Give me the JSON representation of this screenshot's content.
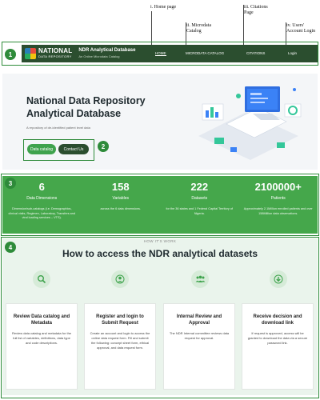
{
  "annotations": {
    "home": "i. Home page",
    "microdata": "ii. Microdata\nCatalog",
    "citations": "iii. Citations\nPage",
    "login": "iv. Users'\nAccount Login"
  },
  "badges": [
    "1",
    "2",
    "3",
    "4"
  ],
  "header": {
    "brand_line1": "NATIONAL",
    "brand_line2": "DATA REPOSITORY",
    "site_title": "NDR Analytical Database",
    "site_subtitle": "An Online Microdata Catalog",
    "nav": [
      "HOME",
      "MICRODATA CATALOG",
      "CITATIONS",
      "Login"
    ]
  },
  "hero": {
    "title": "National Data Repository Analytical Database",
    "subtitle": "A repository of de-identified patient level data",
    "btn_catalog": "Data catalog",
    "btn_contact": "Contact Us"
  },
  "stats": [
    {
      "num": "6",
      "label": "Data Dimensions",
      "desc": "Dimension/sub-catalogs (i.e. Demographics, clinical visits, Regimen, Laboratory, Transfers and viral loading services – VTS)."
    },
    {
      "num": "158",
      "label": "Variables",
      "desc": "across the 6 data dimensions."
    },
    {
      "num": "222",
      "label": "Datasets",
      "desc": "for the 36 states and 1 Federal Capital Territory of Nigeria."
    },
    {
      "num": "2100000+",
      "label": "Patients",
      "desc": "Approximately 2.1Million enrolled patients and over 158Million data observations."
    }
  ],
  "how": {
    "kicker": "HOW IT'S WORK",
    "title": "How to access the NDR analytical datasets",
    "cards": [
      {
        "title": "Review Data catalog and Metadata",
        "desc": "Review data catalog and metadata for the full list of variables, definitions, data type and code descriptions.",
        "icon": "search-icon"
      },
      {
        "title": "Register and login to Submit Request",
        "desc": "Create an account and login to access the online data request form. Fill and submit the following: concept sheet form, ethical approval, and data request form.",
        "icon": "user-icon"
      },
      {
        "title": "Internal Review and Approval",
        "desc": "The NDR Internal committee reviews data request for approval.",
        "icon": "team-icon"
      },
      {
        "title": "Receive decision and download link",
        "desc": "If request is approved, access will be granted to download the data via a secure password link.",
        "icon": "download-icon"
      }
    ]
  },
  "colors": {
    "header": "#2b4e2f",
    "accent": "#45a74b",
    "frame": "#2e8b3a"
  }
}
